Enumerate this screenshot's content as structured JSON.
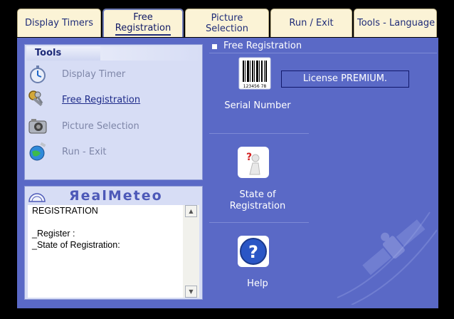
{
  "tabs": [
    {
      "label": "Display Timers",
      "active": false
    },
    {
      "label": "Free\nRegistration",
      "active": true
    },
    {
      "label": "Picture\nSelection",
      "active": false
    },
    {
      "label": "Run / Exit",
      "active": false
    },
    {
      "label": "Tools - Language",
      "active": false
    }
  ],
  "tools": {
    "title": "Tools",
    "items": [
      {
        "label": "Display Timer",
        "icon": "stopwatch-icon",
        "active": false
      },
      {
        "label": "Free Registration",
        "icon": "keys-icon",
        "active": true
      },
      {
        "label": "Picture Selection",
        "icon": "camera-icon",
        "active": false
      },
      {
        "label": "Run - Exit",
        "icon": "globe-satellite-icon",
        "active": false
      }
    ]
  },
  "info": {
    "brand": "ЯealMeteo",
    "lines": [
      "REGISTRATION",
      "",
      "_Register :",
      "_State of Registration:"
    ]
  },
  "right": {
    "header": "Free Registration",
    "serial": {
      "label": "Serial Number",
      "barcode_text": "123456 78",
      "icon": "barcode-icon"
    },
    "license_status": "License PREMIUM.",
    "state": {
      "label": "State of\nRegistration",
      "icon": "question-figure-icon"
    },
    "help": {
      "label": "Help",
      "icon": "help-icon"
    }
  },
  "colors": {
    "panel": "#5a69c6",
    "tab": "#fbf3d6",
    "light_panel": "#d7ddf5"
  }
}
